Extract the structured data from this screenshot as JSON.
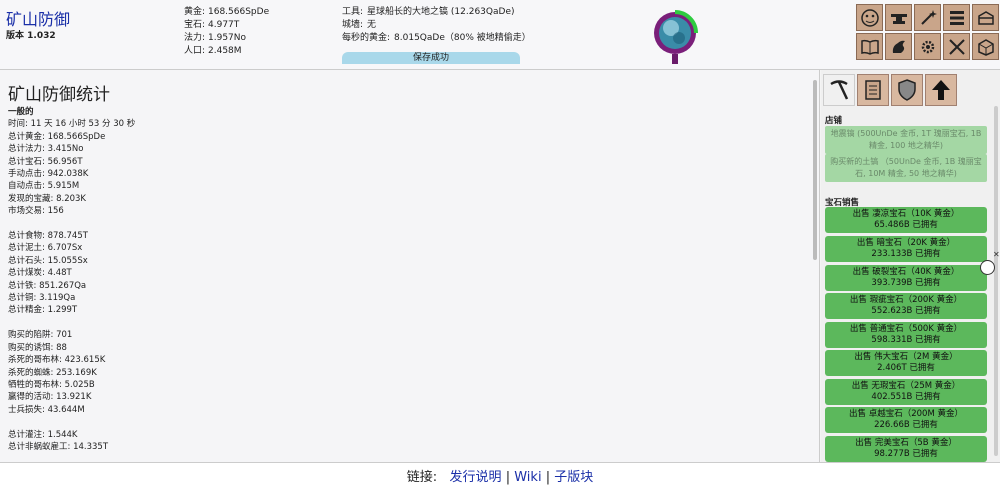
{
  "header": {
    "title": "矿山防御",
    "version": "版本 1.032",
    "resources": [
      {
        "label": "黄金:",
        "value": "168.566SpDe"
      },
      {
        "label": "宝石:",
        "value": "4.977T"
      },
      {
        "label": "法力:",
        "value": "1.957No"
      },
      {
        "label": "人口:",
        "value": "2.458M"
      }
    ],
    "tool_label": "工具:",
    "tool_value": "星球船长的大地之镐 (12.263QaDe)",
    "wall_label": "城墙:",
    "wall_value": "无",
    "gold_per_sec_label": "每秒的黄金:",
    "gold_per_sec_value": "8.015QaDe（80% 被地精偷走）",
    "save_status": "保存成功"
  },
  "stats": {
    "title": "矿山防御统计",
    "general_head": "一般的",
    "groups": [
      [
        {
          "label": "时间:",
          "value": "11 天 16 小时 53 分 30 秒"
        },
        {
          "label": "总计黄金:",
          "value": "168.566SpDe"
        },
        {
          "label": "总计法力:",
          "value": "3.415No"
        },
        {
          "label": "总计宝石:",
          "value": "56.956T"
        },
        {
          "label": "手动点击:",
          "value": "942.038K"
        },
        {
          "label": "自动点击:",
          "value": "5.915M"
        },
        {
          "label": "发现的宝藏:",
          "value": "8.203K"
        },
        {
          "label": "市场交易:",
          "value": "156"
        }
      ],
      [
        {
          "label": "总计食物:",
          "value": "878.745T"
        },
        {
          "label": "总计泥土:",
          "value": "6.707Sx"
        },
        {
          "label": "总计石头:",
          "value": "15.055Sx"
        },
        {
          "label": "总计煤炭:",
          "value": "4.48T"
        },
        {
          "label": "总计铁:",
          "value": "851.267Qa"
        },
        {
          "label": "总计铜:",
          "value": "3.119Qa"
        },
        {
          "label": "总计精金:",
          "value": "1.299T"
        }
      ],
      [
        {
          "label": "购买的陷阱:",
          "value": "701"
        },
        {
          "label": "购买的诱饵:",
          "value": "88"
        },
        {
          "label": "杀死的哥布林:",
          "value": "423.615K"
        },
        {
          "label": "杀死的蜘蛛:",
          "value": "253.169K"
        },
        {
          "label": "牺牲的哥布林:",
          "value": "5.025B"
        },
        {
          "label": "赢得的活动:",
          "value": "13.921K"
        },
        {
          "label": "士兵损失:",
          "value": "43.644M"
        }
      ],
      [
        {
          "label": "总计灌注:",
          "value": "1.544K"
        },
        {
          "label": "总计非蜗蚁雇工:",
          "value": "14.335T"
        }
      ]
    ]
  },
  "shop": {
    "store_label": "店铺",
    "upgrades": [
      "地震镐 (500UnDe 金币, 1T 瑰丽宝石, 1B 精金, 100 地之精华)",
      "购买新的土镐 （50UnDe 金币, 1B 瑰丽宝石, 10M 精金, 50 地之精华)"
    ],
    "gem_sales_label": "宝石销售",
    "gems": [
      {
        "title": "出售 凄凉宝石（10K 黄金）",
        "owned": "65.486B 已拥有"
      },
      {
        "title": "出售 暗宝石（20K 黄金）",
        "owned": "233.133B 已拥有"
      },
      {
        "title": "出售 破裂宝石（40K 黄金）",
        "owned": "393.739B 已拥有"
      },
      {
        "title": "出售 瑕疵宝石（200K 黄金）",
        "owned": "552.623B 已拥有"
      },
      {
        "title": "出售 普通宝石（500K 黄金）",
        "owned": "598.331B 已拥有"
      },
      {
        "title": "出售 伟大宝石（2M 黄金）",
        "owned": "2.406T 已拥有"
      },
      {
        "title": "出售 无瑕宝石（25M 黄金）",
        "owned": "402.551B 已拥有"
      },
      {
        "title": "出售 卓越宝石（200M 黄金）",
        "owned": "226.66B 已拥有"
      },
      {
        "title": "出售 完美宝石（5B 黄金）",
        "owned": "98.277B 已拥有"
      }
    ]
  },
  "footer": {
    "prefix": "链接:",
    "links": [
      "发行说明",
      "Wiki",
      "子版块"
    ],
    "sep": "|"
  },
  "colors": {
    "gem_button": "#5cb85c",
    "upgrade_disabled": "#a4d7a4",
    "tool_button": "#c9a58a",
    "link": "#1a2fa8"
  }
}
